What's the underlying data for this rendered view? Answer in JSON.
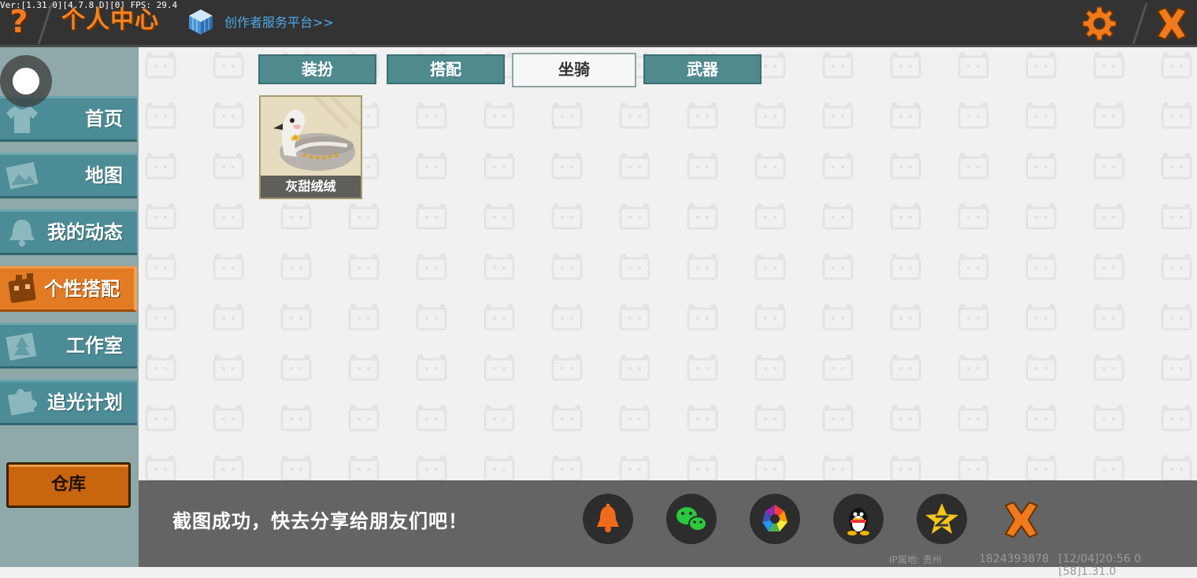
{
  "debug_text": "Ver:[1.31.0][4.7.8.D][0] FPS: 29.4",
  "header": {
    "help_symbol": "?",
    "title": "个人中心",
    "creator_link": "创作者服务平台>>"
  },
  "sidebar": {
    "items": [
      {
        "label": "首页",
        "icon": "shirt-icon"
      },
      {
        "label": "地图",
        "icon": "map-icon"
      },
      {
        "label": "我的动态",
        "icon": "bell-icon"
      },
      {
        "label": "个性搭配",
        "icon": "character-icon",
        "active": true
      },
      {
        "label": "工作室",
        "icon": "tree-book-icon"
      },
      {
        "label": "追光计划",
        "icon": "puzzle-icon"
      }
    ],
    "warehouse_label": "仓库"
  },
  "tabs": [
    {
      "label": "装扮"
    },
    {
      "label": "搭配"
    },
    {
      "label": "坐骑",
      "active": true
    },
    {
      "label": "武器"
    }
  ],
  "mounts": [
    {
      "name": "灰甜绒绒"
    }
  ],
  "share_bar": {
    "message": "截图成功，快去分享给朋友们吧！",
    "icons": [
      "bell-icon",
      "wechat-icon",
      "moments-icon",
      "qq-icon",
      "qzone-icon"
    ]
  },
  "footer": {
    "ip_location": "IP属地: 贵州",
    "user_id": "1824393878",
    "timestamp": "[12/04]20:56 0  [58]1.31.0"
  },
  "colors": {
    "accent_orange": "#f5821f",
    "nav_teal": "#4c8c96",
    "header_bg": "#333333",
    "link_blue": "#4fa9e8"
  }
}
